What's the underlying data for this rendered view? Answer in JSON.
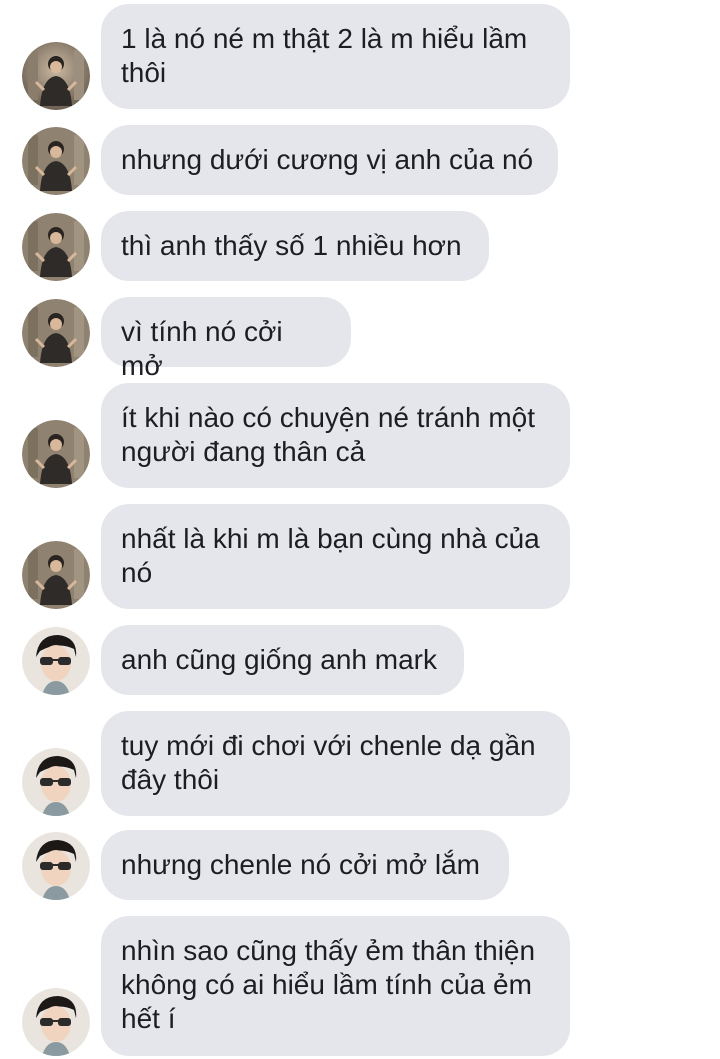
{
  "conversation": {
    "messages": [
      {
        "sender": "a",
        "text": "1 là nó né m thật 2 là m hiểu lầm\nthôi"
      },
      {
        "sender": "a",
        "text": "nhưng dưới cương vị anh của nó"
      },
      {
        "sender": "a",
        "text": "thì anh thấy số 1 nhiều hơn"
      },
      {
        "sender": "a",
        "text": "vì tính nó cởi mở"
      },
      {
        "sender": "a",
        "text": "ít khi nào có chuyện né tránh một\nngười đang thân cả"
      },
      {
        "sender": "a",
        "text": "nhất là khi m là bạn cùng nhà của\nnó"
      },
      {
        "sender": "b",
        "text": "anh cũng giống anh mark"
      },
      {
        "sender": "b",
        "text": "tuy mới đi chơi với chenle dạ gần\nđây thôi"
      },
      {
        "sender": "b",
        "text": "nhưng chenle nó cởi mở lắm"
      },
      {
        "sender": "b",
        "text": "nhìn sao cũng thấy ẻm thân thiện\nkhông có ai hiểu lầm tính của ẻm\nhết í"
      }
    ]
  },
  "colors": {
    "bubble_bg": "#e4e6eb",
    "text": "#1c1e21",
    "background": "#ffffff"
  }
}
